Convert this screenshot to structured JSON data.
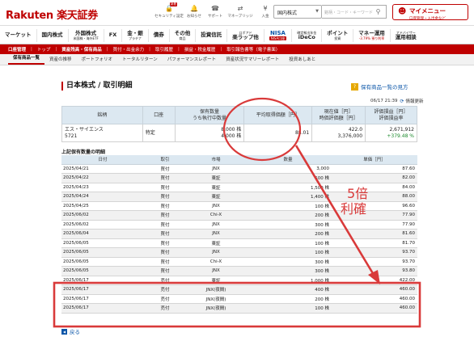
{
  "header": {
    "logo": "Rakuten 楽天証券",
    "new_badge": "新着",
    "icons": [
      {
        "icon": "lock-icon",
        "label": "セキュリティ設定"
      },
      {
        "icon": "bell-icon",
        "label": "お知らせ"
      },
      {
        "icon": "headset-icon",
        "label": "サポート"
      },
      {
        "icon": "bridge-icon",
        "label": "マネーブリッジ"
      },
      {
        "icon": "deposit-icon",
        "label": "入金"
      },
      {
        "icon": "cart-icon",
        "label": "注文"
      }
    ],
    "market_select": "国内株式",
    "search_placeholder": "銘柄・コード・キーワード",
    "my_menu": {
      "title": "マイメニュー",
      "sub": "口座管理・入出金など"
    }
  },
  "nav": [
    {
      "main": "マーケット",
      "sub": ""
    },
    {
      "main": "国内株式",
      "sub": ""
    },
    {
      "main": "外国株式",
      "sub": "米国株・海外ETF"
    },
    {
      "main": "FX",
      "sub": ""
    },
    {
      "main": "金・銀",
      "sub": "プラチナ"
    },
    {
      "main": "債券",
      "sub": ""
    },
    {
      "main": "その他",
      "sub": "商品"
    },
    {
      "main": "投資信託",
      "sub": ""
    },
    {
      "main": "楽ラップ他",
      "sub": "ロボアド"
    },
    {
      "main": "NISA",
      "sub": "NISA口座"
    },
    {
      "main": "iDeCo",
      "sub": "確定拠出年金"
    },
    {
      "main": "ポイント",
      "sub": "投資"
    },
    {
      "main": "マネー運用",
      "sub": "-3.79% 預り利率"
    },
    {
      "main": "運用相談",
      "sub": "アドバイザー"
    }
  ],
  "breadcrumb": [
    "口座管理",
    "トップ",
    "資産残高・保有商品",
    "買付・出金余力",
    "取引履歴",
    "損益・税金履歴",
    "取引報告書等（電子書面）"
  ],
  "subtabs": [
    "保有商品一覧",
    "資産の推移",
    "ポートフォリオ",
    "トータルリターン",
    "パフォーマンスレポート",
    "資産状況サマリーレポート",
    "投資あしあと"
  ],
  "page": {
    "title": "日本株式 / 取引明細",
    "help_link": "保有商品一覧の見方",
    "updated_time": "06/17 21:39",
    "refresh_label": "情報更新",
    "back_label": "戻る",
    "detail_caption": "上記保有数量の明細"
  },
  "holding": {
    "headers": [
      "銘柄",
      "口座",
      "保有数量\nうち執行中数量",
      "平均取得価額［円］",
      "現在値［円］\n時価評価額［円］",
      "評価損益［円］\n評価損益率"
    ],
    "name": "エス・サイエンス",
    "code": "5721",
    "account": "特定",
    "quantity": "8,000 株",
    "executing": "4,000 株",
    "avg_price": "88.01",
    "current_price": "422.0",
    "market_value": "3,376,000",
    "pl": "2,671,912",
    "pl_rate": "+379.48 %"
  },
  "details": {
    "headers": [
      "日付",
      "取引",
      "市場",
      "数量",
      "単価［円］"
    ],
    "rows": [
      {
        "date": "2025/04/21",
        "trade": "買付",
        "market": "JNX",
        "qty": "3,000",
        "price": "87.60"
      },
      {
        "date": "2025/04/22",
        "trade": "買付",
        "market": "東証",
        "qty": "500 株",
        "price": "82.00"
      },
      {
        "date": "2025/04/23",
        "trade": "買付",
        "market": "東証",
        "qty": "1,500 株",
        "price": "84.00"
      },
      {
        "date": "2025/04/24",
        "trade": "買付",
        "market": "東証",
        "qty": "1,400 株",
        "price": "88.00"
      },
      {
        "date": "2025/04/25",
        "trade": "買付",
        "market": "JNX",
        "qty": "100 株",
        "price": "96.60"
      },
      {
        "date": "2025/06/02",
        "trade": "買付",
        "market": "Chi-X",
        "qty": "200 株",
        "price": "77.90"
      },
      {
        "date": "2025/06/02",
        "trade": "買付",
        "market": "JNX",
        "qty": "300 株",
        "price": "77.90"
      },
      {
        "date": "2025/06/04",
        "trade": "買付",
        "market": "JNX",
        "qty": "200 株",
        "price": "81.60"
      },
      {
        "date": "2025/06/05",
        "trade": "買付",
        "market": "東証",
        "qty": "100 株",
        "price": "81.70"
      },
      {
        "date": "2025/06/05",
        "trade": "買付",
        "market": "JNX",
        "qty": "100 株",
        "price": "93.70"
      },
      {
        "date": "2025/06/05",
        "trade": "買付",
        "market": "Chi-X",
        "qty": "300 株",
        "price": "93.70"
      },
      {
        "date": "2025/06/05",
        "trade": "買付",
        "market": "JNX",
        "qty": "300 株",
        "price": "93.80"
      },
      {
        "date": "2025/06/17",
        "trade": "売付",
        "market": "東証",
        "qty": "1,000 株",
        "price": "422.00"
      },
      {
        "date": "2025/06/17",
        "trade": "売付",
        "market": "JNX(夜間)",
        "qty": "400 株",
        "price": "460.00"
      },
      {
        "date": "2025/06/17",
        "trade": "売付",
        "market": "JNX(夜間)",
        "qty": "200 株",
        "price": "460.00"
      },
      {
        "date": "2025/06/17",
        "trade": "売付",
        "market": "JNX(夜間)",
        "qty": "100 株",
        "price": "460.00"
      }
    ]
  },
  "annotation": {
    "text_line1": "5倍",
    "text_line2": "利確",
    "color": "#d93a3a"
  },
  "colors": {
    "brand": "#bf0000",
    "header_cell": "#dce8f1",
    "link": "#0a55a8",
    "gain": "#1c8a2c"
  }
}
